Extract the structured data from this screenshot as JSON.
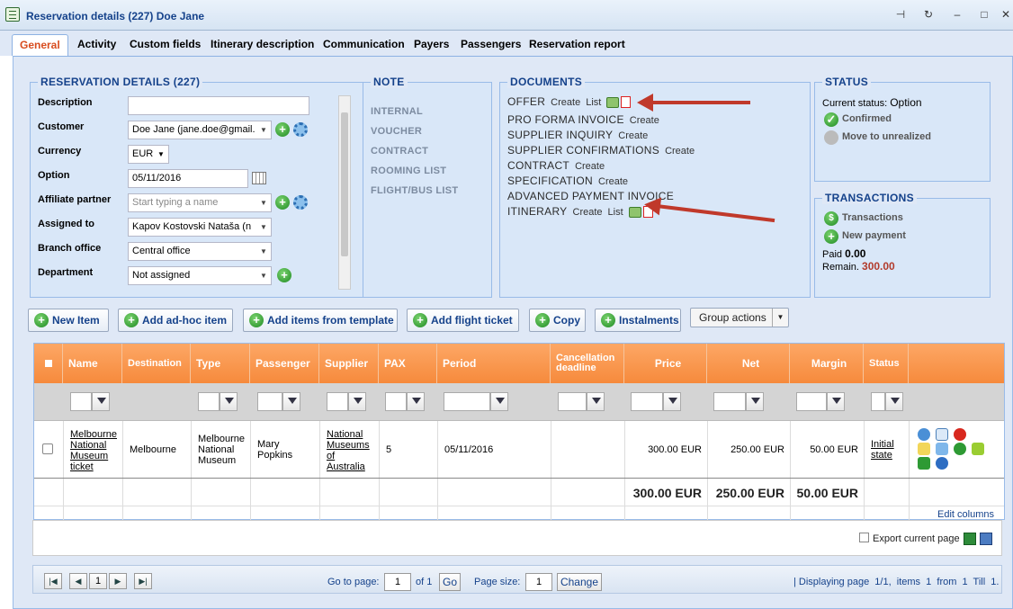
{
  "window": {
    "title": "Reservation details (227) Doe Jane"
  },
  "tabs": [
    "General",
    "Activity",
    "Custom fields",
    "Itinerary description",
    "Communication",
    "Payers",
    "Passengers",
    "Reservation report"
  ],
  "reservation": {
    "legend": "RESERVATION DETAILS (227)",
    "labels": {
      "description": "Description",
      "customer": "Customer",
      "currency": "Currency",
      "option": "Option",
      "affiliate": "Affiliate partner",
      "assigned": "Assigned to",
      "branch": "Branch office",
      "department": "Department"
    },
    "values": {
      "description": "",
      "customer": "Doe Jane (jane.doe@gmail.",
      "currency": "EUR",
      "option": "05/11/2016",
      "affiliate_placeholder": "Start typing a name",
      "assigned": "Kapov Kostovski Nataša (n",
      "branch": "Central office",
      "department": "Not assigned"
    }
  },
  "note": {
    "legend": "NOTE",
    "items": [
      "INTERNAL",
      "VOUCHER",
      "CONTRACT",
      "ROOMING LIST",
      "FLIGHT/BUS LIST"
    ]
  },
  "documents": {
    "legend": "DOCUMENTS",
    "create": "Create",
    "list": "List",
    "rows": [
      "OFFER",
      "PRO FORMA INVOICE",
      "SUPPLIER INQUIRY",
      "SUPPLIER CONFIRMATIONS",
      "CONTRACT",
      "SPECIFICATION",
      "ADVANCED PAYMENT INVOICE",
      "ITINERARY"
    ]
  },
  "status": {
    "legend": "STATUS",
    "current_label": "Current status:",
    "current_value": "Option",
    "confirmed": "Confirmed",
    "move": "Move to unrealized"
  },
  "transactions": {
    "legend": "TRANSACTIONS",
    "transactions": "Transactions",
    "new_payment": "New payment",
    "paid_label": "Paid",
    "paid_value": "0.00",
    "remain_label": "Remain.",
    "remain_value": "300.00"
  },
  "toolbar": {
    "new_item": "New Item",
    "adhoc": "Add ad-hoc item",
    "template": "Add items from template",
    "flight": "Add flight ticket",
    "copy": "Copy",
    "instalments": "Instalments",
    "group": "Group actions"
  },
  "grid": {
    "headers": [
      "Name",
      "Destination",
      "Type",
      "Passenger",
      "Supplier",
      "PAX",
      "Period",
      "Cancellation deadline",
      "Price",
      "Net",
      "Margin",
      "Status"
    ],
    "row": {
      "name": "Melbourne National Museum ticket",
      "destination": "Melbourne",
      "type": "Melbourne National Museum",
      "passenger": "Mary Popkins",
      "supplier": "National Museums of Australia",
      "pax": "5",
      "period": "05/11/2016",
      "price": "300.00 EUR",
      "net": "250.00 EUR",
      "margin": "50.00 EUR",
      "status": "Initial state"
    },
    "totals": {
      "price": "300.00 EUR",
      "net": "250.00 EUR",
      "margin": "50.00 EUR"
    },
    "edit_columns": "Edit columns",
    "export": "Export current page"
  },
  "pager": {
    "page": "1",
    "goto_label": "Go to page:",
    "goto_value": "1",
    "of": "of 1",
    "go": "Go",
    "size_label": "Page size:",
    "size_value": "1",
    "change": "Change",
    "info": "| Displaying page  1/1,  items  1  from  1  Till  1."
  }
}
